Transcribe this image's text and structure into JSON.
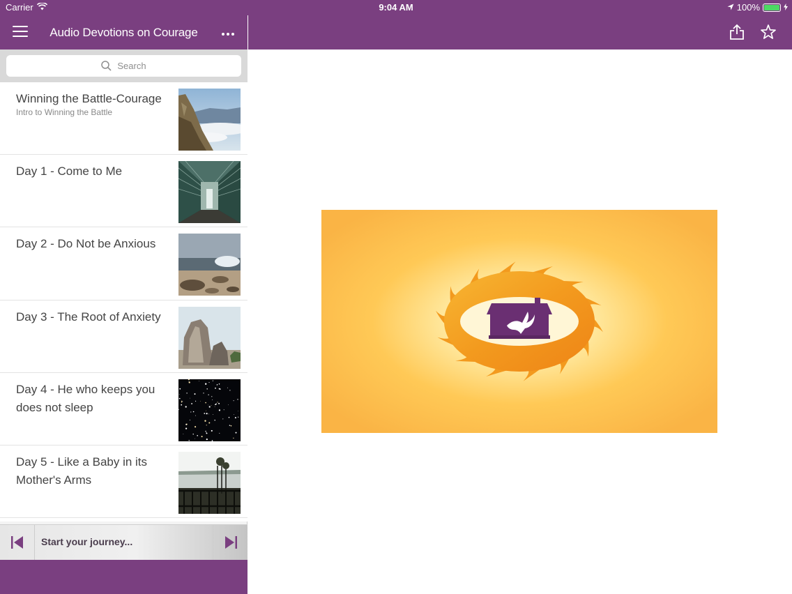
{
  "status": {
    "carrier": "Carrier",
    "time": "9:04 AM",
    "battery": "100%",
    "battery_level": 1.0
  },
  "sidebar": {
    "title": "Audio Devotions on Courage",
    "menu_icon": "hamburger-menu-icon",
    "more_icon": "ellipsis-icon",
    "search_placeholder": "Search",
    "items": [
      {
        "title": "Winning the Battle-Courage",
        "subtitle": "Intro to Winning the Battle",
        "thumb": "mountain-valley"
      },
      {
        "title": "Day 1 - Come to Me",
        "subtitle": "",
        "thumb": "tunnel"
      },
      {
        "title": "Day 2 - Do Not be Anxious",
        "subtitle": "",
        "thumb": "beach-rocks"
      },
      {
        "title": "Day 3 - The Root of Anxiety",
        "subtitle": "",
        "thumb": "boulders"
      },
      {
        "title": "Day 4 - He who keeps you does not sleep",
        "subtitle": "",
        "thumb": "night-sky"
      },
      {
        "title": "Day 5 - Like a Baby in its Mother's Arms",
        "subtitle": "",
        "thumb": "lake-trees"
      }
    ]
  },
  "player": {
    "text": "Start your journey..."
  },
  "toolbar": {
    "share_icon": "share-icon",
    "favorite_icon": "star-icon"
  },
  "colors": {
    "brand_purple": "#7a3f80",
    "hero_orange": "#fab445",
    "flame_orange": "#f39a1e"
  }
}
